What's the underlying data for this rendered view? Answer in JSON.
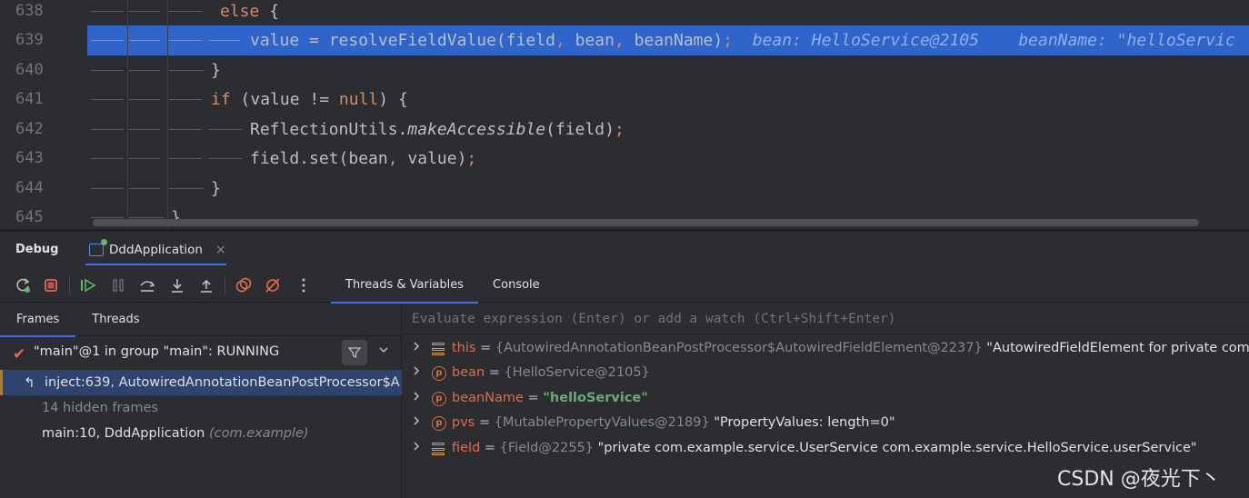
{
  "editor": {
    "lines": [
      {
        "number": "638",
        "segments": [
          {
            "t": "else",
            "c": "kw"
          },
          {
            "t": " {",
            "c": "pu"
          }
        ]
      },
      {
        "number": "639",
        "segments": [
          {
            "t": "value = resolveFieldValue(field",
            "c": "pu"
          },
          {
            "t": ",",
            "c": "com"
          },
          {
            "t": " bean",
            "c": "pu"
          },
          {
            "t": ",",
            "c": "com"
          },
          {
            "t": " beanName)",
            "c": "pu"
          },
          {
            "t": ";",
            "c": "com"
          },
          {
            "t": "  bean: HelloService@2105    beanName: \"helloServic",
            "c": "inline-hint"
          }
        ]
      },
      {
        "number": "640",
        "segments": [
          {
            "t": "}",
            "c": "pu"
          }
        ]
      },
      {
        "number": "641",
        "segments": [
          {
            "t": "if",
            "c": "kw"
          },
          {
            "t": " (value != ",
            "c": "pu"
          },
          {
            "t": "null",
            "c": "kw"
          },
          {
            "t": ") {",
            "c": "pu"
          }
        ]
      },
      {
        "number": "642",
        "segments": [
          {
            "t": "ReflectionUtils.",
            "c": "pu"
          },
          {
            "t": "makeAccessible",
            "c": "it"
          },
          {
            "t": "(field)",
            "c": "pu"
          },
          {
            "t": ";",
            "c": "com"
          }
        ]
      },
      {
        "number": "643",
        "segments": [
          {
            "t": "field.set(bean",
            "c": "pu"
          },
          {
            "t": ",",
            "c": "com"
          },
          {
            "t": " value)",
            "c": "pu"
          },
          {
            "t": ";",
            "c": "com"
          }
        ]
      },
      {
        "number": "644",
        "segments": [
          {
            "t": "}",
            "c": "pu"
          }
        ]
      },
      {
        "number": "645",
        "segments": [
          {
            "t": "}",
            "c": "pu"
          }
        ]
      }
    ]
  },
  "debug": {
    "title": "Debug",
    "run_tab": "DddApplication",
    "close_glyph": "×",
    "subtabs": [
      "Threads & Variables",
      "Console"
    ],
    "frames_tabs": [
      "Frames",
      "Threads"
    ],
    "thread": "\"main\"@1 in group \"main\": RUNNING",
    "frames": [
      {
        "text": "inject:639, AutowiredAnnotationBeanPostProcessor$A",
        "pkg": ""
      },
      {
        "text": "14 hidden frames",
        "pkg": ""
      },
      {
        "text": "main:10, DddApplication",
        "pkg": "(com.example)"
      }
    ],
    "eval_placeholder": "Evaluate expression (Enter) or add a watch (Ctrl+Shift+Enter)",
    "variables": [
      {
        "icon": "field",
        "name": "this",
        "type": "{AutowiredAnnotationBeanPostProcessor$AutowiredFieldElement@2237}",
        "value": "\"AutowiredFieldElement for private com",
        "value_style": "plain"
      },
      {
        "icon": "param",
        "name": "bean",
        "type": "{HelloService@2105}",
        "value": "",
        "value_style": "plain"
      },
      {
        "icon": "param",
        "name": "beanName",
        "type": "",
        "value": "\"helloService\"",
        "value_style": "string"
      },
      {
        "icon": "param",
        "name": "pvs",
        "type": "{MutablePropertyValues@2189}",
        "value": "\"PropertyValues: length=0\"",
        "value_style": "plain"
      },
      {
        "icon": "field",
        "name": "field",
        "type": "{Field@2255}",
        "value": "\"private com.example.service.UserService com.example.service.HelloService.userService\"",
        "value_style": "plain"
      }
    ]
  },
  "watermark": "CSDN @夜光下丶",
  "colors": {
    "accent": "#3574f0",
    "highlight_line": "#2f65ca",
    "keyword": "#cf8e6d",
    "string": "#6aab73",
    "var_name": "#e06c4a"
  }
}
